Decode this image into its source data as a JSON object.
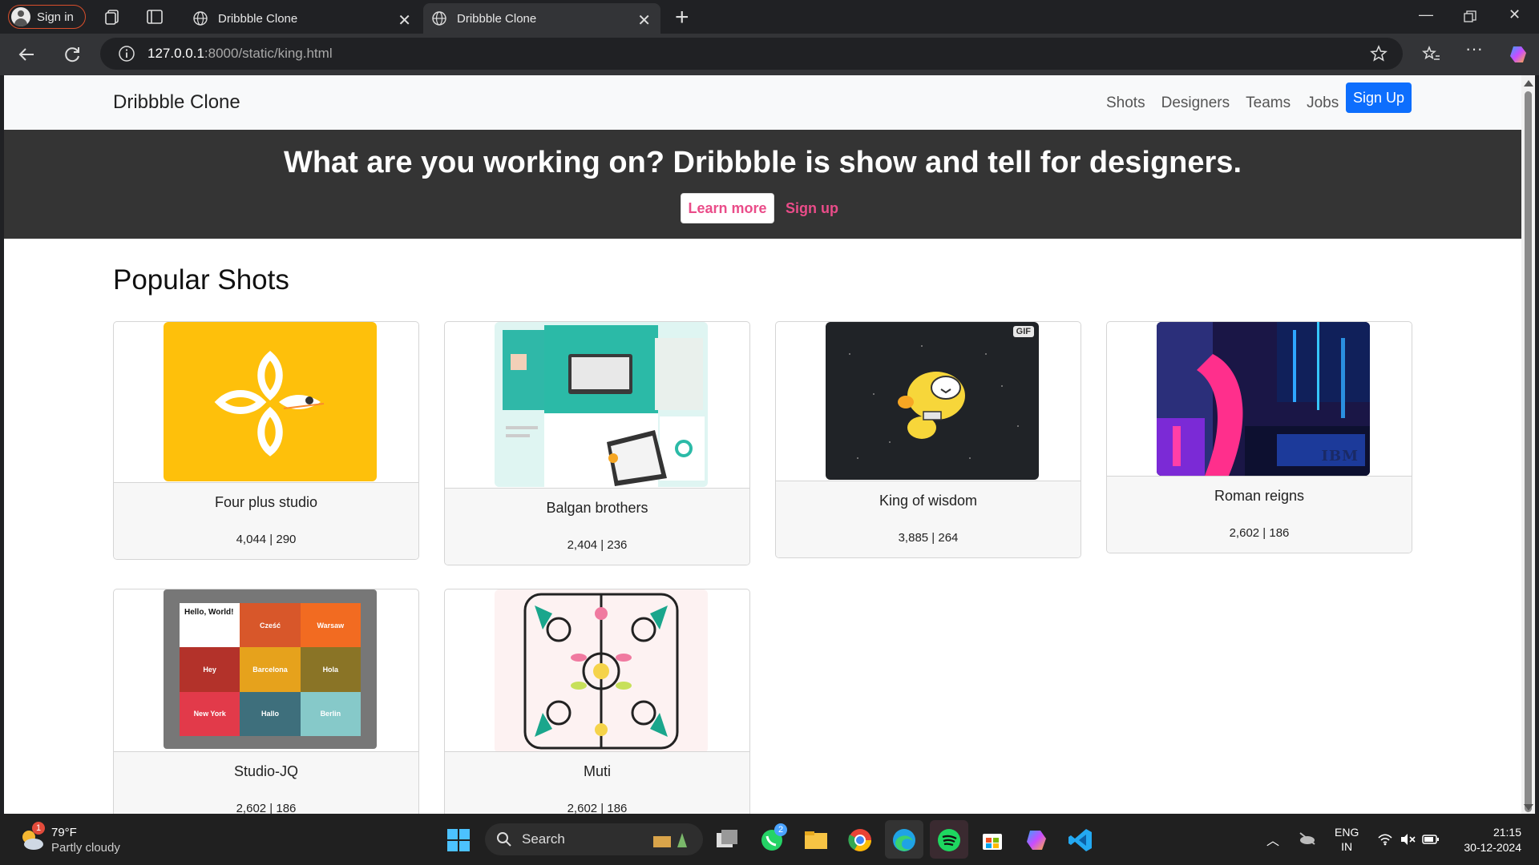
{
  "browser": {
    "signin_label": "Sign in",
    "tabs": [
      {
        "title": "Dribbble Clone"
      },
      {
        "title": "Dribbble Clone"
      }
    ],
    "url_host": "127.0.0.1",
    "url_rest": ":8000/static/king.html"
  },
  "site": {
    "brand": "Dribbble Clone",
    "nav": [
      "Shots",
      "Designers",
      "Teams",
      "Jobs"
    ],
    "signup_button": "Sign Up",
    "hero_title": "What are you working on? Dribbble is show and tell for designers.",
    "learn_more": "Learn more",
    "hero_signup": "Sign up",
    "section_title": "Popular Shots",
    "accent": "#ea4c89",
    "primary": "#0d6efd",
    "shots": [
      {
        "title": "Four plus studio",
        "stats": "4,044 | 290"
      },
      {
        "title": "Balgan brothers",
        "stats": "2,404 | 236"
      },
      {
        "title": "King of wisdom",
        "stats": "3,885 | 264",
        "badge": "GIF"
      },
      {
        "title": "Roman reigns",
        "stats": "2,602 | 186",
        "badge": "IBM"
      },
      {
        "title": "Studio-JQ",
        "stats": "2,602 | 186",
        "tiles": [
          "Hello, World!",
          "Cześć",
          "Warsaw",
          "Hey",
          "Barcelona",
          "Hola",
          "New York",
          "Hallo",
          "Berlin"
        ]
      },
      {
        "title": "Muti",
        "stats": "2,602 | 186"
      }
    ]
  },
  "taskbar": {
    "temp": "79°F",
    "condition": "Partly cloudy",
    "weather_badge": "1",
    "search": "Search",
    "whatsapp_badge": "2",
    "lang_top": "ENG",
    "lang_bottom": "IN",
    "time": "21:15",
    "date": "30-12-2024"
  }
}
